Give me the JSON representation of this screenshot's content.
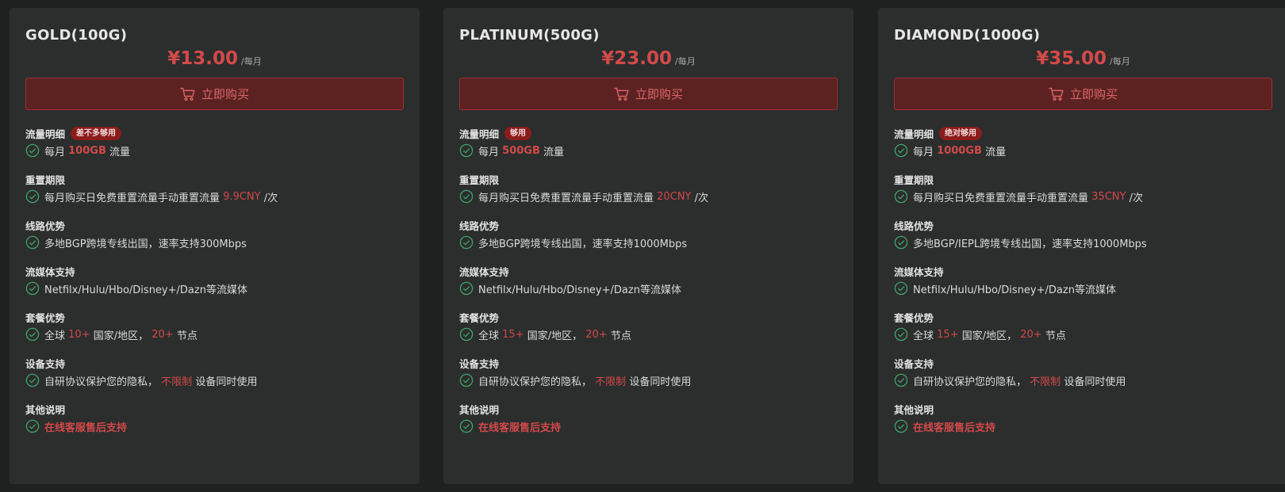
{
  "plans": [
    {
      "name": "GOLD(100G)",
      "price": "¥13.00",
      "per": "/每月",
      "buy_label": "立即购买",
      "traffic_label": "流量明细",
      "traffic_badge": "差不多够用",
      "traffic_pre": "每月",
      "traffic_amount": "100GB",
      "traffic_post": "流量",
      "reset_label": "重置期限",
      "reset_pre": "每月购买日免费重置流量手动重置流量",
      "reset_price": "9.9CNY",
      "reset_post": "/次",
      "line_label": "线路优势",
      "line_text": "多地BGP跨境专线出国，速率支持300Mbps",
      "stream_label": "流媒体支持",
      "stream_text": "Netfilx/Hulu/Hbo/Disney+/Dazn等流媒体",
      "plan_label": "套餐优势",
      "plan_pre": "全球",
      "plan_countries": "10+",
      "plan_mid": "国家/地区，",
      "plan_nodes": "20+",
      "plan_post": "节点",
      "device_label": "设备支持",
      "device_pre": "自研协议保护您的隐私，",
      "device_unlimited": "不限制",
      "device_post": "设备同时使用",
      "other_label": "其他说明",
      "other_text": "在线客服售后支持"
    },
    {
      "name": "PLATINUM(500G)",
      "price": "¥23.00",
      "per": "/每月",
      "buy_label": "立即购买",
      "traffic_label": "流量明细",
      "traffic_badge": "够用",
      "traffic_pre": "每月",
      "traffic_amount": "500GB",
      "traffic_post": "流量",
      "reset_label": "重置期限",
      "reset_pre": "每月购买日免费重置流量手动重置流量",
      "reset_price": "20CNY",
      "reset_post": "/次",
      "line_label": "线路优势",
      "line_text": "多地BGP跨境专线出国，速率支持1000Mbps",
      "stream_label": "流媒体支持",
      "stream_text": "Netfilx/Hulu/Hbo/Disney+/Dazn等流媒体",
      "plan_label": "套餐优势",
      "plan_pre": "全球",
      "plan_countries": "15+",
      "plan_mid": "国家/地区，",
      "plan_nodes": "20+",
      "plan_post": "节点",
      "device_label": "设备支持",
      "device_pre": "自研协议保护您的隐私，",
      "device_unlimited": "不限制",
      "device_post": "设备同时使用",
      "other_label": "其他说明",
      "other_text": "在线客服售后支持"
    },
    {
      "name": "DIAMOND(1000G)",
      "price": "¥35.00",
      "per": "/每月",
      "buy_label": "立即购买",
      "traffic_label": "流量明细",
      "traffic_badge": "绝对够用",
      "traffic_pre": "每月",
      "traffic_amount": "1000GB",
      "traffic_post": "流量",
      "reset_label": "重置期限",
      "reset_pre": "每月购买日免费重置流量手动重置流量",
      "reset_price": "35CNY",
      "reset_post": "/次",
      "line_label": "线路优势",
      "line_text": "多地BGP/IEPL跨境专线出国，速率支持1000Mbps",
      "stream_label": "流媒体支持",
      "stream_text": "Netfilx/Hulu/Hbo/Disney+/Dazn等流媒体",
      "plan_label": "套餐优势",
      "plan_pre": "全球",
      "plan_countries": "15+",
      "plan_mid": "国家/地区，",
      "plan_nodes": "20+",
      "plan_post": "节点",
      "device_label": "设备支持",
      "device_pre": "自研协议保护您的隐私，",
      "device_unlimited": "不限制",
      "device_post": "设备同时使用",
      "other_label": "其他说明",
      "other_text": "在线客服售后支持"
    }
  ],
  "colors": {
    "accent": "#d24a4a",
    "button_bg": "#5c2222",
    "card_bg": "#2c2d2d",
    "page_bg": "#1f2020",
    "check": "#3fa36b"
  },
  "icons": {
    "cart": "cart-icon",
    "check": "check-circle-icon"
  }
}
